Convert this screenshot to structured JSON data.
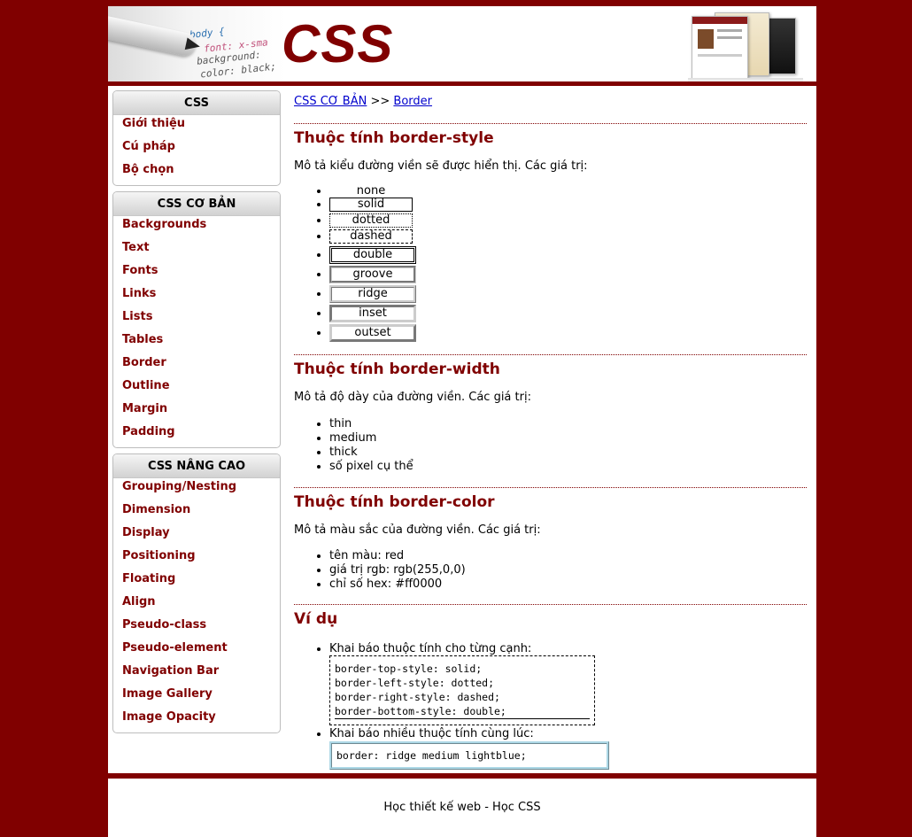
{
  "header": {
    "logo_text": "CSS",
    "code_lines": [
      "body {",
      "font: x-sma",
      "background:",
      "color: black;"
    ]
  },
  "sidebar": {
    "groups": [
      {
        "title": "CSS",
        "items": [
          "Giới thiệu",
          "Cú pháp",
          "Bộ chọn"
        ]
      },
      {
        "title": "CSS CƠ BẢN",
        "items": [
          "Backgrounds",
          "Text",
          "Fonts",
          "Links",
          "Lists",
          "Tables",
          "Border",
          "Outline",
          "Margin",
          "Padding"
        ]
      },
      {
        "title": "CSS NÂNG CAO",
        "items": [
          "Grouping/Nesting",
          "Dimension",
          "Display",
          "Positioning",
          "Floating",
          "Align",
          "Pseudo-class",
          "Pseudo-element",
          "Navigation Bar",
          "Image Gallery",
          "Image Opacity"
        ]
      }
    ]
  },
  "breadcrumb": {
    "parent": "CSS CƠ BẢN",
    "separator": ">>",
    "current": "Border"
  },
  "sections": {
    "style": {
      "heading": "Thuộc tính border-style",
      "desc": "Mô tả kiểu đường viền sẽ được hiển thị. Các giá trị:",
      "values": [
        "none",
        "solid",
        "dotted",
        "dashed",
        "double",
        "groove",
        "ridge",
        "inset",
        "outset"
      ]
    },
    "width": {
      "heading": "Thuộc tính border-width",
      "desc": "Mô tả độ dày của đường viền. Các giá trị:",
      "values": [
        "thin",
        "medium",
        "thick",
        "số pixel cụ thể"
      ]
    },
    "color": {
      "heading": "Thuộc tính border-color",
      "desc": "Mô tả màu sắc của đường viền. Các giá trị:",
      "values": [
        "tên màu: red",
        "giá trị rgb: rgb(255,0,0)",
        "chỉ số hex: #ff0000"
      ]
    },
    "example": {
      "heading": "Ví dụ",
      "item1": "Khai báo thuộc tính cho từng cạnh:",
      "code1": [
        "border-top-style: solid;",
        "border-left-style: dotted;",
        "border-right-style: dashed;",
        "border-bottom-style: double;"
      ],
      "item2": "Khai báo nhiều thuộc tính cùng lúc:",
      "code2": "border: ridge medium lightblue;"
    }
  },
  "footer": {
    "text": "Học thiết kế web - Học CSS"
  },
  "colors": {
    "brand": "#800000",
    "link": "#0000cc",
    "lightblue": "#add8e6"
  }
}
